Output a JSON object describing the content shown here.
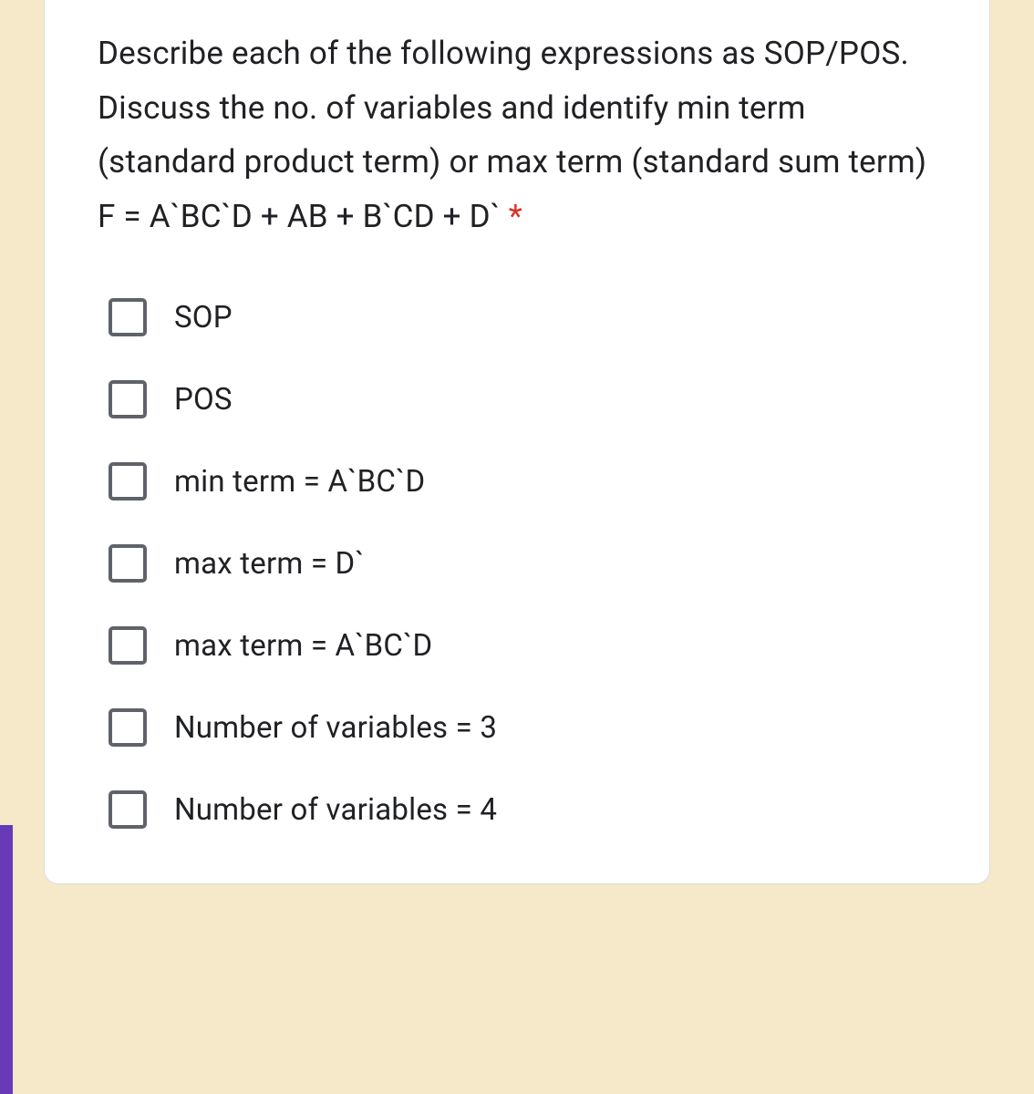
{
  "question": {
    "text": "Describe each of the following expressions as SOP/POS. Discuss the no. of variables and identify min term (standard product term) or max term (standard sum term) F = A`BC`D + AB + B`CD + D`",
    "required_marker": "*"
  },
  "options": [
    {
      "label": "SOP"
    },
    {
      "label": "POS"
    },
    {
      "label": "min term = A`BC`D"
    },
    {
      "label": "max term = D`"
    },
    {
      "label": "max term = A`BC`D"
    },
    {
      "label": "Number of variables = 3"
    },
    {
      "label": "Number of variables = 4"
    }
  ]
}
